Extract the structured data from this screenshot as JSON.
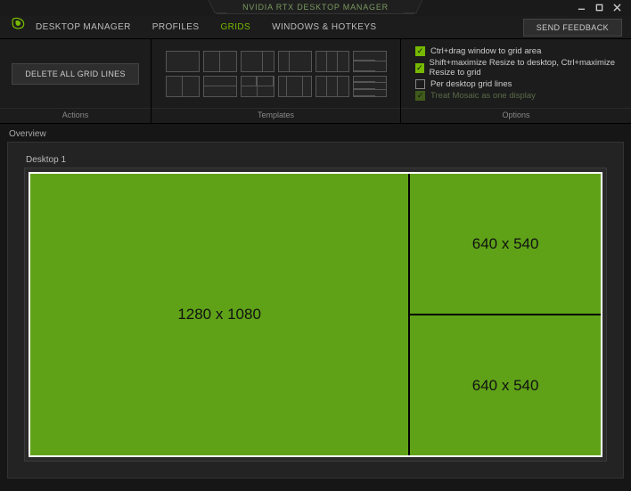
{
  "app": {
    "title": "NVIDIA RTX DESKTOP MANAGER"
  },
  "nav": {
    "tabs": [
      "DESKTOP MANAGER",
      "PROFILES",
      "GRIDS",
      "WINDOWS & HOTKEYS"
    ],
    "active": 2,
    "feedback": "SEND FEEDBACK"
  },
  "toolbar": {
    "actions": {
      "label": "Actions",
      "delete_btn": "DELETE ALL GRID LINES"
    },
    "templates": {
      "label": "Templates"
    },
    "options": {
      "label": "Options",
      "items": [
        {
          "text": "Ctrl+drag window to grid area",
          "checked": true,
          "enabled": true
        },
        {
          "text": "Shift+maximize Resize to desktop, Ctrl+maximize Resize to grid",
          "checked": true,
          "enabled": true
        },
        {
          "text": "Per desktop grid lines",
          "checked": false,
          "enabled": true
        },
        {
          "text": "Treat Mosaic as one display",
          "checked": true,
          "enabled": false
        }
      ]
    }
  },
  "overview": {
    "label": "Overview",
    "desktop_label": "Desktop 1",
    "cells": {
      "left": "1280 x 1080",
      "top_right": "640 x 540",
      "bottom_right": "640 x 540"
    }
  }
}
